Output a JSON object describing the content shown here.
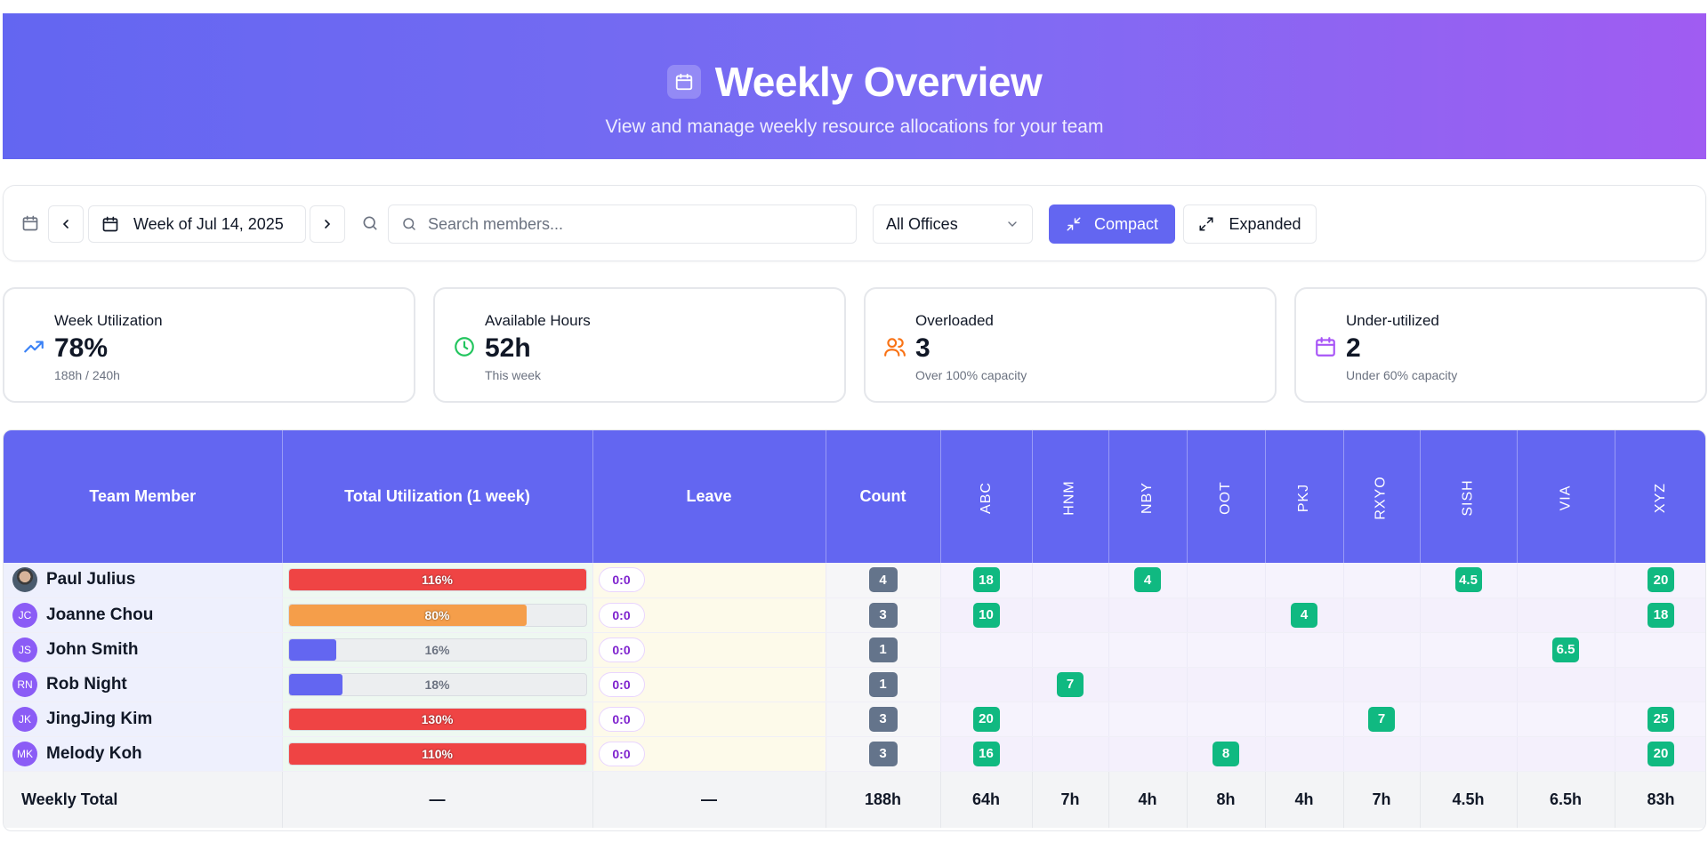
{
  "header": {
    "title": "Weekly Overview",
    "subtitle": "View and manage weekly resource allocations for your team"
  },
  "toolbar": {
    "week_label": "Week of Jul 14, 2025",
    "search_placeholder": "Search members...",
    "search_value": "",
    "office_selected": "All Offices",
    "compact_label": "Compact",
    "expanded_label": "Expanded"
  },
  "stats": [
    {
      "label": "Week Utilization",
      "value": "78%",
      "sub": "188h / 240h",
      "icon": "trending-up-icon",
      "color": "#3b82f6"
    },
    {
      "label": "Available Hours",
      "value": "52h",
      "sub": "This week",
      "icon": "clock-icon",
      "color": "#22c55e"
    },
    {
      "label": "Overloaded",
      "value": "3",
      "sub": "Over 100% capacity",
      "icon": "users-icon",
      "color": "#f97316"
    },
    {
      "label": "Under-utilized",
      "value": "2",
      "sub": "Under 60% capacity",
      "icon": "calendar-icon",
      "color": "#a855f7"
    }
  ],
  "table": {
    "columns": {
      "member": "Team Member",
      "utilization": "Total Utilization (1 week)",
      "leave": "Leave",
      "count": "Count"
    },
    "projects": [
      "ABC",
      "HNM",
      "NBY",
      "OOT",
      "PKJ",
      "RXYO",
      "SISH",
      "VIA",
      "XYZ"
    ],
    "rows": [
      {
        "initials": "",
        "name": "Paul Julius",
        "util": "116%",
        "util_pct": 116,
        "leave": "0:0",
        "count": "4",
        "alloc": [
          "18",
          "",
          "4",
          "",
          "",
          "",
          "4.5",
          "",
          "20"
        ]
      },
      {
        "initials": "JC",
        "name": "Joanne Chou",
        "util": "80%",
        "util_pct": 80,
        "leave": "0:0",
        "count": "3",
        "alloc": [
          "10",
          "",
          "",
          "",
          "4",
          "",
          "",
          "",
          "18"
        ]
      },
      {
        "initials": "JS",
        "name": "John Smith",
        "util": "16%",
        "util_pct": 16,
        "leave": "0:0",
        "count": "1",
        "alloc": [
          "",
          "",
          "",
          "",
          "",
          "",
          "",
          "6.5",
          ""
        ]
      },
      {
        "initials": "RN",
        "name": "Rob Night",
        "util": "18%",
        "util_pct": 18,
        "leave": "0:0",
        "count": "1",
        "alloc": [
          "",
          "7",
          "",
          "",
          "",
          "",
          "",
          "",
          ""
        ]
      },
      {
        "initials": "JK",
        "name": "JingJing Kim",
        "util": "130%",
        "util_pct": 130,
        "leave": "0:0",
        "count": "3",
        "alloc": [
          "20",
          "",
          "",
          "",
          "",
          "7",
          "",
          "",
          "25"
        ]
      },
      {
        "initials": "MK",
        "name": "Melody Koh",
        "util": "110%",
        "util_pct": 110,
        "leave": "0:0",
        "count": "3",
        "alloc": [
          "16",
          "",
          "",
          "8",
          "",
          "",
          "",
          "",
          "20"
        ]
      }
    ],
    "footer": {
      "label": "Weekly Total",
      "utilization": "—",
      "leave": "—",
      "count": "188h",
      "projects": [
        "64h",
        "7h",
        "4h",
        "8h",
        "4h",
        "7h",
        "4.5h",
        "6.5h",
        "83h"
      ]
    }
  },
  "colors": {
    "accent": "#6366f1",
    "over": "#ef4444",
    "mid": "#f59e4a",
    "under": "#6366f1",
    "tag": "#10b981"
  }
}
